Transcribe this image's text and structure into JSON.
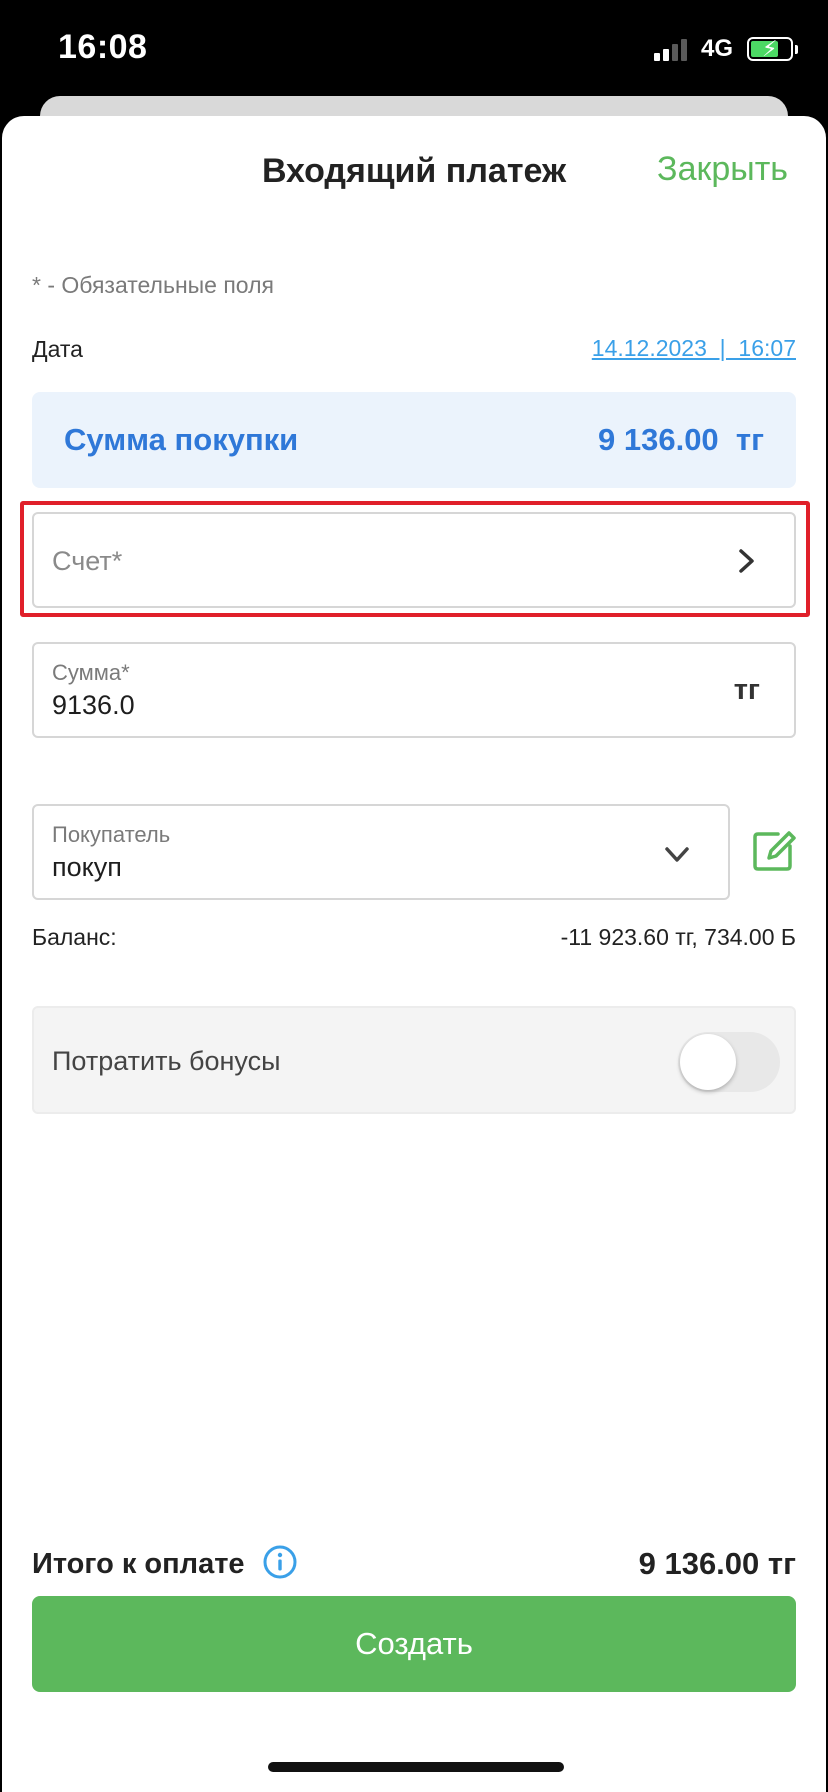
{
  "status_bar": {
    "time": "16:08",
    "network": "4G",
    "icons": [
      "signal-icon",
      "battery-charging-icon"
    ]
  },
  "header": {
    "title": "Входящий платеж",
    "close_label": "Закрыть"
  },
  "form": {
    "required_note": "* - Обязательные поля",
    "date_label": "Дата",
    "date_value": "14.12.2023  |  16:07",
    "summary": {
      "label": "Сумма покупки",
      "value": "9 136.00  тг"
    },
    "account": {
      "placeholder": "Счет*"
    },
    "amount": {
      "label": "Сумма*",
      "value": "9136.0",
      "currency": "тг"
    },
    "buyer": {
      "label": "Покупатель",
      "value": "покуп"
    },
    "balance": {
      "label": "Баланс:",
      "value": "-11 923.60 тг, 734.00 Б"
    },
    "bonus": {
      "label": "Потратить бонусы",
      "enabled": false
    }
  },
  "footer": {
    "total_label": "Итого к оплате",
    "total_value": "9 136.00 тг",
    "create_label": "Создать"
  },
  "colors": {
    "accent_green": "#5cb85c",
    "link_blue": "#3aa0e8",
    "summary_blue": "#2f78d8",
    "highlight_red": "#e0202a"
  }
}
